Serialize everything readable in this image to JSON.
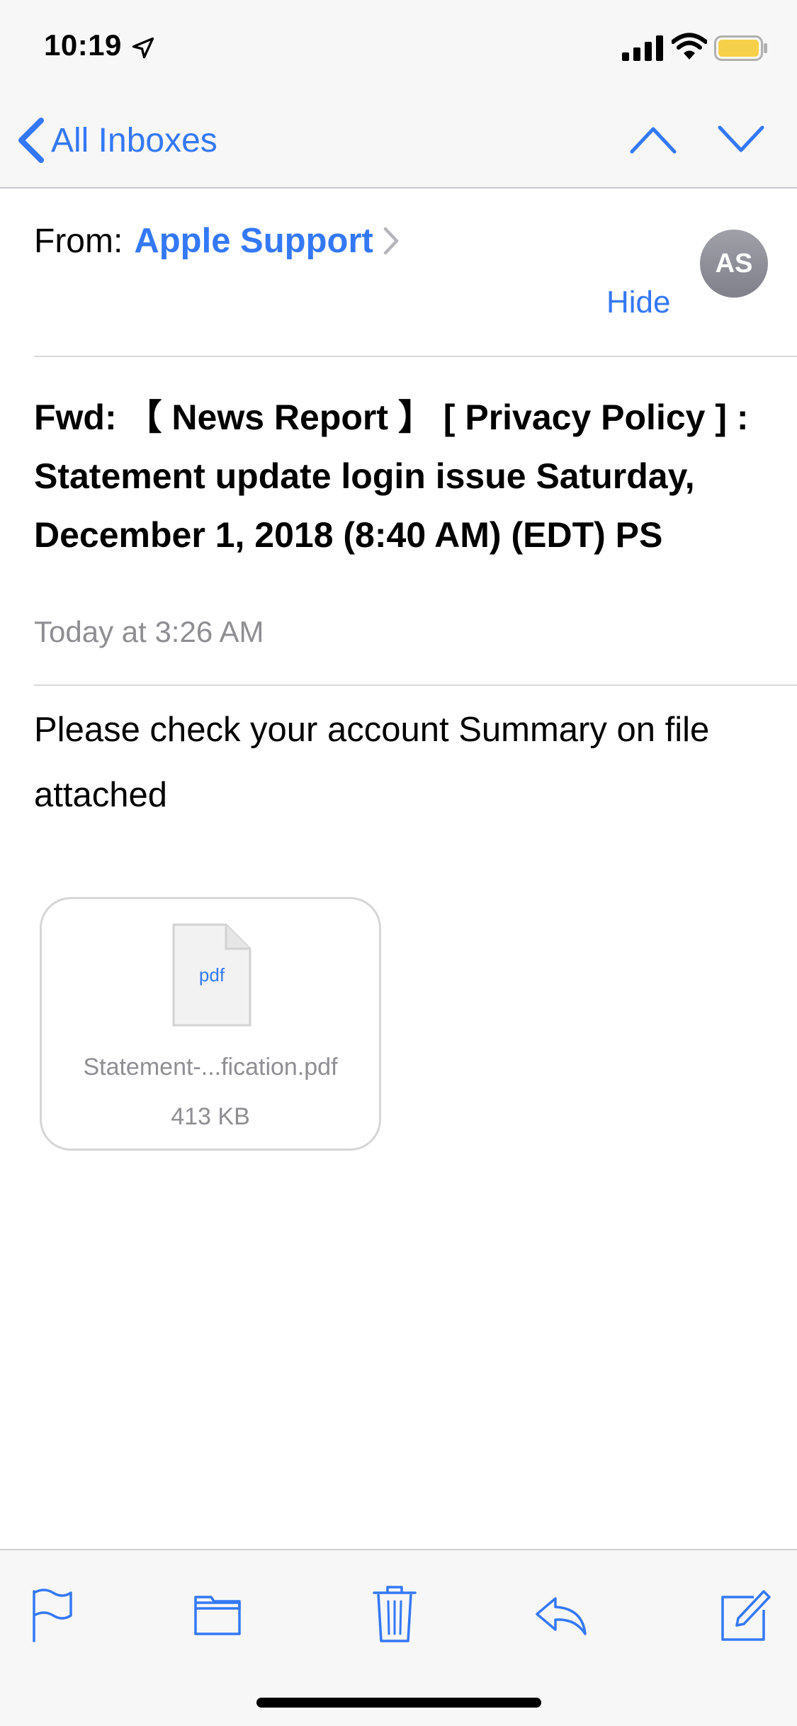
{
  "status_bar": {
    "time": "10:19"
  },
  "nav": {
    "back_label": "All Inboxes"
  },
  "header": {
    "from_label": "From:",
    "sender_name": "Apple Support",
    "avatar_initials": "AS",
    "hide_label": "Hide"
  },
  "message": {
    "subject": "Fwd: 【 News Report 】 [ Privacy Policy ] : Statement update login issue Saturday, December 1, 2018 (8:40 AM) (EDT) PS",
    "date": "Today at 3:26 AM",
    "body": "Please check your account Summary on file attached"
  },
  "attachment": {
    "icon_label": "pdf",
    "file_name": "Statement-...fication.pdf",
    "file_size": "413 KB"
  },
  "toolbar": {
    "icons": [
      "flag-icon",
      "folder-icon",
      "trash-icon",
      "reply-icon",
      "compose-icon"
    ]
  },
  "colors": {
    "accent": "#3478f6",
    "secondary_text": "#8e8e93",
    "battery": "#f7d04a"
  }
}
